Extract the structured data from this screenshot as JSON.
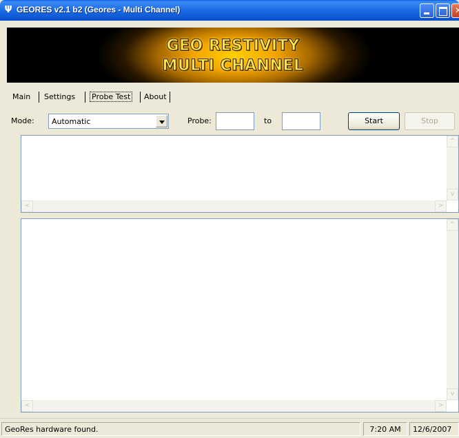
{
  "window": {
    "title": "GEORES v2.1 b2 (Geores - Multi Channel)",
    "app_icon": "Ψ"
  },
  "banner": {
    "line1": "GEO RESTIVITY",
    "line2": "MULTI CHANNEL"
  },
  "tabs": [
    {
      "label": "Main",
      "active": false
    },
    {
      "label": "Settings",
      "active": false
    },
    {
      "label": "Probe Test",
      "active": true
    },
    {
      "label": "About",
      "active": false
    }
  ],
  "controls": {
    "mode_label": "Mode:",
    "mode_value": "Automatic",
    "probe_label": "Probe:",
    "probe_from": "",
    "to_label": "to",
    "probe_to": "",
    "start_label": "Start",
    "stop_label": "Stop"
  },
  "scroll_arrows": {
    "up": "^",
    "down": "v",
    "left": "<",
    "right": ">"
  },
  "statusbar": {
    "message": "GeoRes hardware found.",
    "time": "7:20 AM",
    "date": "12/6/2007"
  }
}
